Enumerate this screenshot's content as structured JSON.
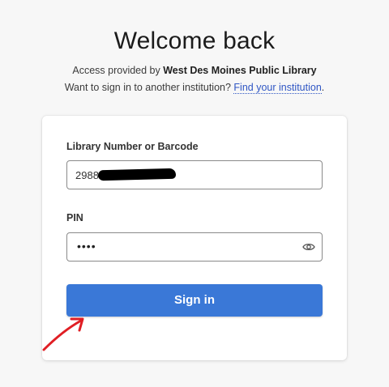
{
  "header": {
    "title": "Welcome back",
    "access_prefix": "Access provided by ",
    "institution_name": "West Des Moines Public Library",
    "switch_prefix": "Want to sign in to another institution? ",
    "find_link": "Find your institution",
    "find_suffix": "."
  },
  "form": {
    "library_label": "Library Number or Barcode",
    "library_value_visible": "2988",
    "pin_label": "PIN",
    "pin_masked": "••••",
    "signin_label": "Sign in"
  },
  "icons": {
    "show_password": "eye-icon"
  },
  "colors": {
    "accent": "#3a78d7",
    "link": "#2f56c4",
    "annotation": "#e01e24"
  }
}
